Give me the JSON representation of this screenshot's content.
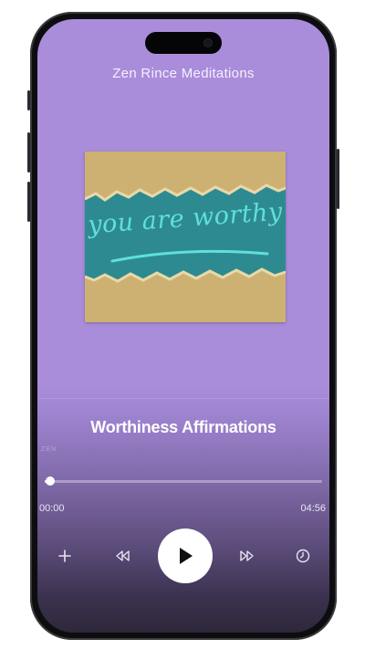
{
  "app": {
    "title": "Zen Rince Meditations"
  },
  "artwork": {
    "text": "you are worthy"
  },
  "track": {
    "title": "Worthiness Affirmations",
    "faint_label": "ZEN"
  },
  "player": {
    "current_time": "00:00",
    "total_time": "04:56",
    "progress": 0.02
  },
  "colors": {
    "background": "#a98ddb",
    "artwork_paper": "#cdb172",
    "artwork_teal": "#2e8a91",
    "artwork_text": "#5fe0d8"
  },
  "icons": {
    "add": "plus-icon",
    "rewind": "rewind-icon",
    "play": "play-icon",
    "fast_forward": "fast-forward-icon",
    "sleep_timer": "timer-icon"
  }
}
